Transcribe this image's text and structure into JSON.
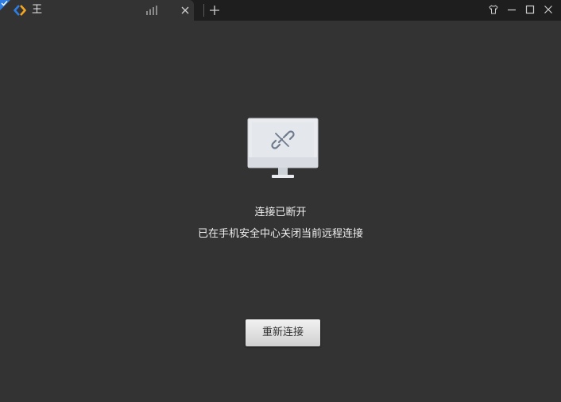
{
  "tab": {
    "title": "王",
    "icon": "remote-desktop-app-icon",
    "signal_icon": "signal-bars-icon",
    "close_icon": "close-icon",
    "active": true
  },
  "titlebar": {
    "new_tab_icon": "plus-icon",
    "controls": [
      "shirt-skin-icon",
      "minimize-icon",
      "maximize-icon",
      "close-icon"
    ]
  },
  "main": {
    "illustration": "disconnected-monitor-icon",
    "status_title": "连接已断开",
    "status_description": "已在手机安全中心关闭当前远程连接",
    "reconnect_label": "重新连接"
  },
  "colors": {
    "background": "#333333",
    "titlebar": "#1e1e1f",
    "badge": "#2f7de1",
    "logo_blue": "#2f7de1",
    "logo_orange": "#f5a623",
    "text": "#f0f0f0"
  }
}
